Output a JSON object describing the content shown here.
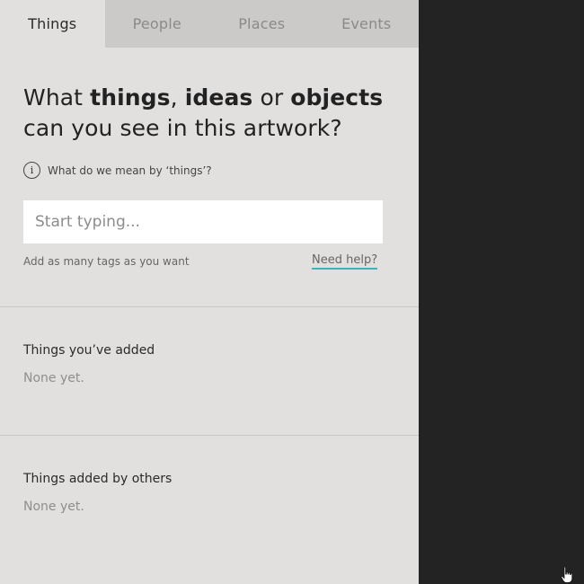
{
  "tabs": [
    {
      "label": "Things",
      "active": true
    },
    {
      "label": "People",
      "active": false
    },
    {
      "label": "Places",
      "active": false
    },
    {
      "label": "Events",
      "active": false
    }
  ],
  "question": {
    "prefix": "What ",
    "word1": "things",
    "sep1": ", ",
    "word2": "ideas",
    "sep2": " or ",
    "word3": "objects",
    "suffix": "can you see in this artwork?"
  },
  "info": {
    "icon": "info-icon",
    "glyph": "i",
    "text": "What do we mean by ‘things’?"
  },
  "search": {
    "placeholder": "Start typing...",
    "value": ""
  },
  "hint": "Add as many tags as you want",
  "help_link": "Need help?",
  "sections": {
    "added": {
      "title": "Things you’ve added",
      "empty": "None yet."
    },
    "others": {
      "title": "Things added by others",
      "empty": "None yet."
    }
  },
  "colors": {
    "panel_bg": "#e1e0df",
    "tab_bar_bg": "#cbcac9",
    "dark_bg": "#232323",
    "link_underline": "#3fb1b8"
  },
  "cursor": {
    "icon": "hand-pointer-icon"
  }
}
